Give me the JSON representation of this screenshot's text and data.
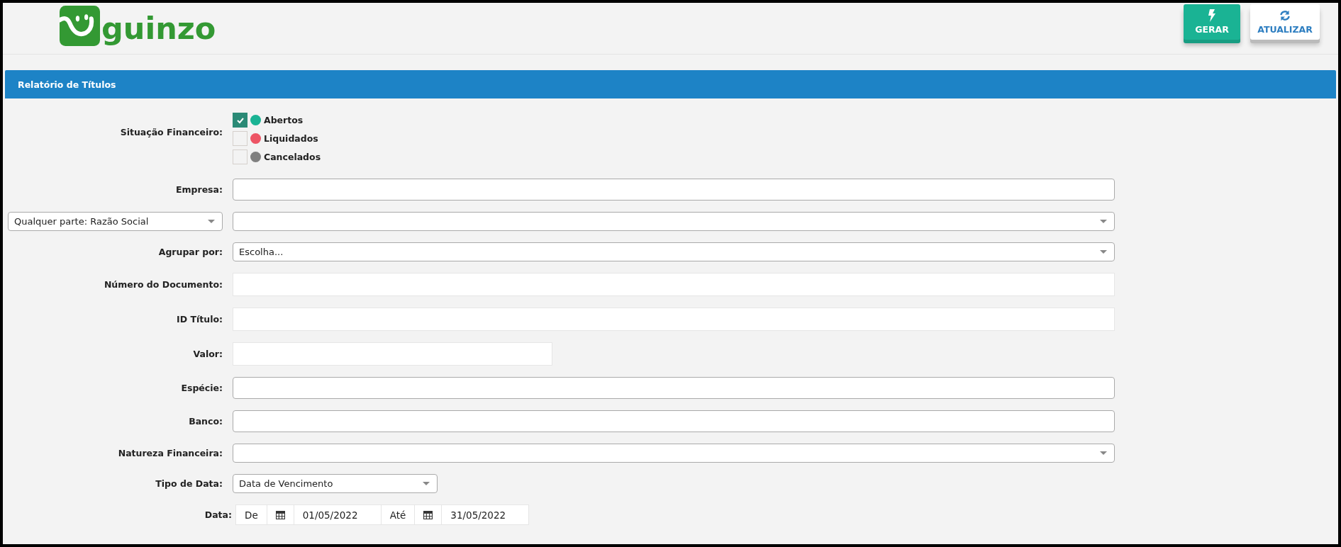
{
  "logo": {
    "text": "guinzo"
  },
  "actions": [
    {
      "kind": "generate",
      "label": "GERAR"
    },
    {
      "kind": "refresh",
      "label": "ATUALIZAR"
    }
  ],
  "panel": {
    "title": "Relatório de Títulos"
  },
  "status_filter": {
    "label": "Situação Financeiro:",
    "options": [
      {
        "label": "Abertos",
        "checked": true,
        "color": "#1ab394"
      },
      {
        "label": "Liquidados",
        "checked": false,
        "color": "#ed5565"
      },
      {
        "label": "Cancelados",
        "checked": false,
        "color": "#808080"
      }
    ]
  },
  "fields": [
    {
      "kind": "text",
      "label": "Empresa:"
    },
    {
      "kind": "select",
      "label_select": "Qualquer parte: Razão Social"
    },
    {
      "kind": "select",
      "label": "Agrupar por:",
      "value": "Escolha..."
    },
    {
      "kind": "plain",
      "label": "Número do Documento:"
    },
    {
      "kind": "plain",
      "label": "ID Título:"
    },
    {
      "kind": "plain-short",
      "label": "Valor:"
    },
    {
      "kind": "text",
      "label": "Espécie:"
    },
    {
      "kind": "text",
      "label": "Banco:"
    },
    {
      "kind": "select",
      "label": "Natureza Financeira:"
    },
    {
      "kind": "select-short",
      "label": "Tipo de Data:",
      "value": "Data de Vencimento"
    }
  ],
  "date_range": {
    "label": "Data:",
    "from_label": "De",
    "from": "01/05/2022",
    "to_label": "Até",
    "to": "31/05/2022"
  }
}
